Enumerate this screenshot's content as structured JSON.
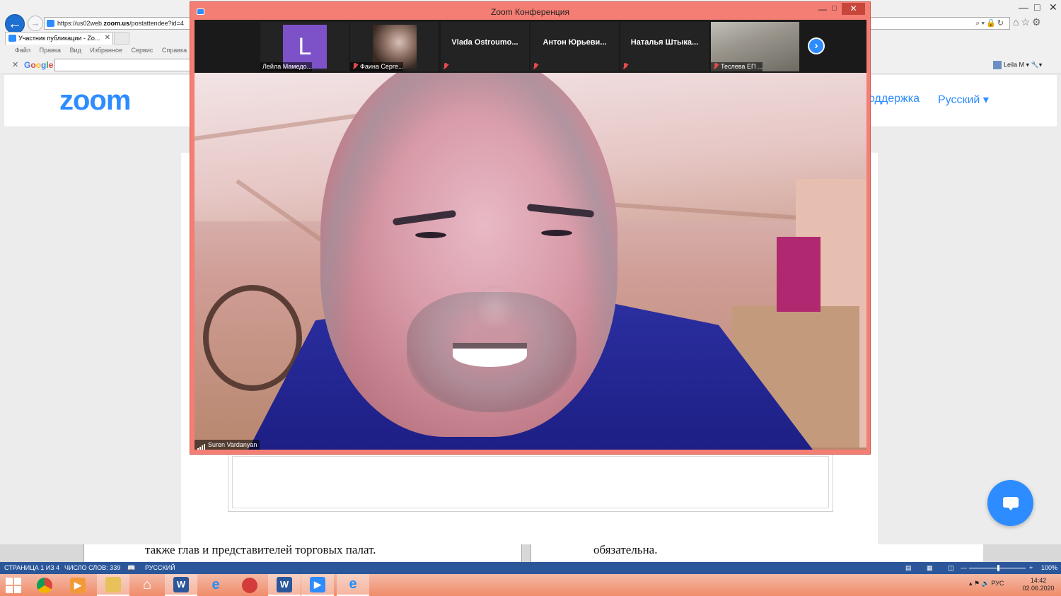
{
  "browser": {
    "url_prefix": "https://us02web.",
    "url_domain": "zoom.us",
    "url_rest": "/postattendee?id=4",
    "tab_title": "Участник публикации - Zo...",
    "menu": [
      "Файл",
      "Правка",
      "Вид",
      "Избранное",
      "Сервис",
      "Справка"
    ],
    "google_label": "Google",
    "user": "Leila M"
  },
  "zoom_web": {
    "logo": "zoom",
    "support": "оддержка",
    "language": "Русский"
  },
  "word": {
    "left_text": "также глав и представителей торговых палат.",
    "right_text": "обязательна.",
    "status": {
      "page": "СТРАНИЦА 1 ИЗ 4",
      "words": "ЧИСЛО СЛОВ: 339",
      "lang": "РУССКИЙ",
      "zoom": "100%"
    }
  },
  "taskbar": {
    "lang": "РУС",
    "time": "14:42",
    "date": "02.06.2020"
  },
  "meeting": {
    "window_title": "Zoom Конференция",
    "participants": [
      {
        "name": "Лейла Мамедо...",
        "avatar_letter": "L",
        "muted": false
      },
      {
        "name": "Фаина Серге...",
        "muted": true
      },
      {
        "name": "Vlada  Ostroumo...",
        "muted": true
      },
      {
        "name": "Антон  Юрьеви...",
        "muted": true
      },
      {
        "name": "Наталья  Штыка...",
        "muted": true
      },
      {
        "name": "Теслева ЕП ...",
        "muted": true
      }
    ],
    "speaker": "Suren Vardanyan"
  },
  "colors": {
    "zoom_blue": "#2d8cff",
    "window_frame": "#f47e74",
    "word_blue": "#2b579a"
  }
}
